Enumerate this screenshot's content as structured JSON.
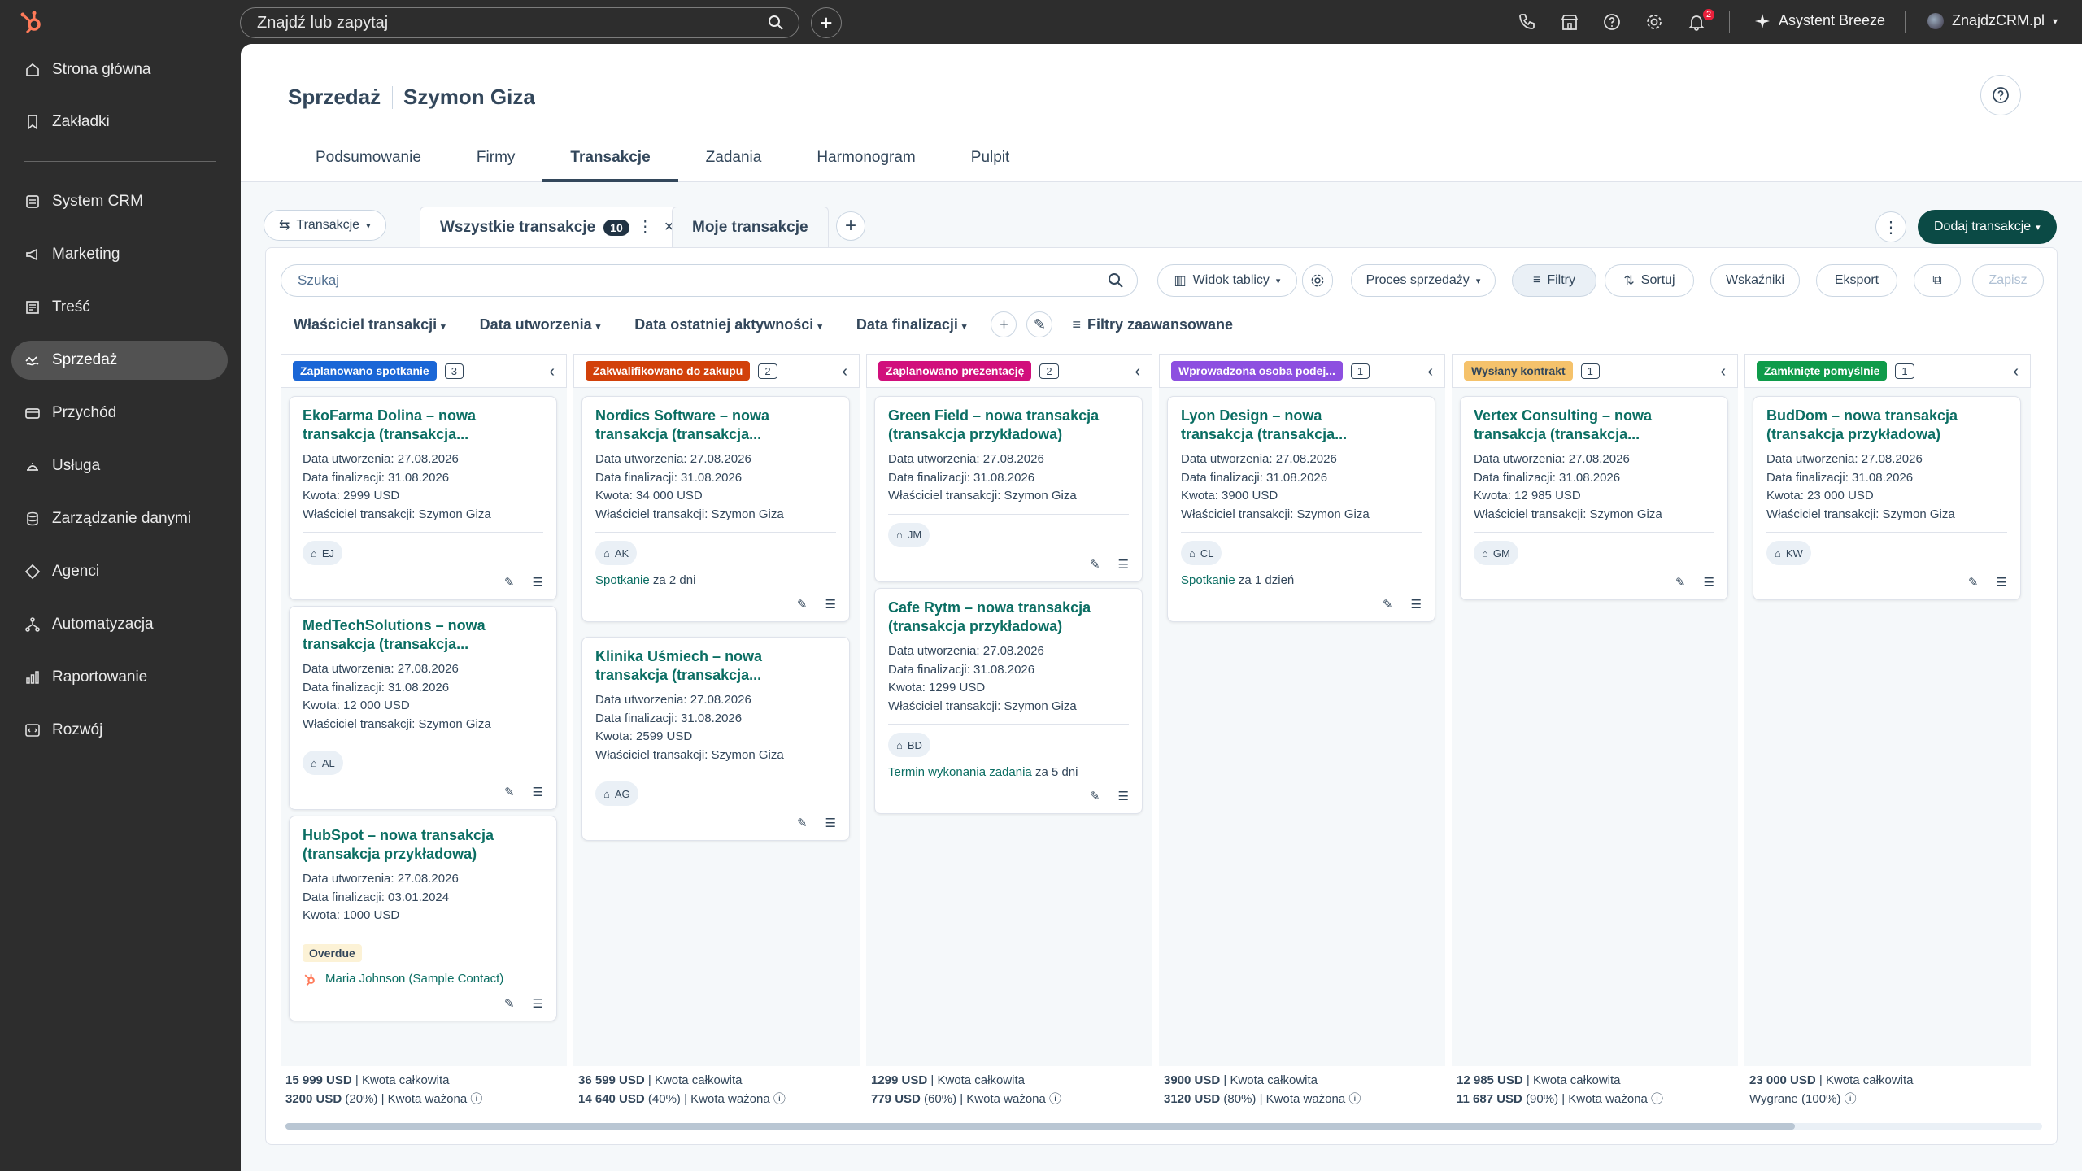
{
  "topbar": {
    "search_placeholder": "Znajdź lub zapytaj",
    "assistant_label": "Asystent Breeze",
    "notification_count": "2",
    "account_label": "ZnajdzCRM.pl"
  },
  "sidebar": {
    "items": [
      {
        "label": "Strona główna",
        "icon": "home-icon"
      },
      {
        "label": "Zakładki",
        "icon": "bookmark-icon"
      },
      {
        "label": "System CRM",
        "icon": "crm-icon"
      },
      {
        "label": "Marketing",
        "icon": "megaphone-icon"
      },
      {
        "label": "Treść",
        "icon": "content-icon"
      },
      {
        "label": "Sprzedaż",
        "icon": "sales-icon"
      },
      {
        "label": "Przychód",
        "icon": "revenue-icon"
      },
      {
        "label": "Usługa",
        "icon": "service-icon"
      },
      {
        "label": "Zarządzanie danymi",
        "icon": "database-icon"
      },
      {
        "label": "Agenci",
        "icon": "agents-icon"
      },
      {
        "label": "Automatyzacja",
        "icon": "automation-icon"
      },
      {
        "label": "Raportowanie",
        "icon": "reporting-icon"
      },
      {
        "label": "Rozwój",
        "icon": "development-icon"
      }
    ],
    "active": "Sprzedaż"
  },
  "header": {
    "title": "Sprzedaż",
    "subtitle": "Szymon Giza",
    "tabs": [
      "Podsumowanie",
      "Firmy",
      "Transakcje",
      "Zadania",
      "Harmonogram",
      "Pulpit"
    ],
    "active_tab": "Transakcje"
  },
  "views": {
    "object_label": "Transakcje",
    "tab_all": "Wszystkie transakcje",
    "tab_all_count": "10",
    "tab_mine": "Moje transakcje",
    "add_deal_label": "Dodaj transakcje"
  },
  "toolbar": {
    "search_placeholder": "Szukaj",
    "board_view": "Widok tablicy",
    "pipeline": "Proces sprzedaży",
    "filters": "Filtry",
    "sort": "Sortuj",
    "metrics": "Wskaźniki",
    "export": "Eksport",
    "save": "Zapisz"
  },
  "filters": {
    "owner": "Właściciel transakcji",
    "created": "Data utworzenia",
    "last_activity": "Data ostatniej aktywności",
    "close_date": "Data finalizacji",
    "advanced": "Filtry zaawansowane"
  },
  "columns": [
    {
      "stage": "Zaplanowano spotkanie",
      "count": "3",
      "color": "#1a66d6",
      "text_color": "#ffffff",
      "cards": [
        {
          "title1": "EkoFarma Dolina – nowa",
          "title2": "transakcja (transakcja...",
          "lines": [
            "Data utworzenia: 27.08.2026",
            "Data finalizacji: 31.08.2026",
            "Kwota: 2999 USD",
            "Właściciel transakcji: Szymon Giza"
          ],
          "initials": "EJ"
        },
        {
          "title1": "MedTechSolutions – nowa",
          "title2": "transakcja (transakcja...",
          "lines": [
            "Data utworzenia: 27.08.2026",
            "Data finalizacji: 31.08.2026",
            "Kwota: 12 000 USD",
            "Właściciel transakcji: Szymon Giza"
          ],
          "initials": "AL"
        },
        {
          "title1": "HubSpot – nowa transakcja",
          "title2": "(transakcja przykładowa)",
          "lines": [
            "Data utworzenia: 27.08.2026",
            "Data finalizacji: 03.01.2024",
            "Kwota: 1000 USD"
          ],
          "overdue": "Overdue",
          "contact": "Maria Johnson (Sample Contact)"
        }
      ],
      "total": "15 999 USD",
      "total_label": "| Kwota całkowita",
      "weighted": "3200 USD",
      "weighted_label": "(20%) | Kwota ważona"
    },
    {
      "stage": "Zakwalifikowano do zakupu",
      "count": "2",
      "color": "#d2410a",
      "text_color": "#ffffff",
      "cards": [
        {
          "title1": "Nordics Software – nowa",
          "title2": "transakcja (transakcja...",
          "lines": [
            "Data utworzenia: 27.08.2026",
            "Data finalizacji: 31.08.2026",
            "Kwota: 34 000 USD",
            "Właściciel transakcji: Szymon Giza"
          ],
          "initials": "AK",
          "task_link": "Spotkanie",
          "task_due": "za 2 dni"
        },
        {
          "title1": "Klinika Uśmiech – nowa",
          "title2": "transakcja (transakcja...",
          "lines": [
            "Data utworzenia: 27.08.2026",
            "Data finalizacji: 31.08.2026",
            "Kwota: 2599 USD",
            "Właściciel transakcji: Szymon Giza"
          ],
          "initials": "AG"
        }
      ],
      "total": "36 599 USD",
      "total_label": "| Kwota całkowita",
      "weighted": "14 640 USD",
      "weighted_label": "(40%) | Kwota ważona"
    },
    {
      "stage": "Zaplanowano prezentację",
      "count": "2",
      "color": "#d10f7c",
      "text_color": "#ffffff",
      "cards": [
        {
          "title1": "Green Field – nowa transakcja",
          "title2": "(transakcja przykładowa)",
          "lines": [
            "Data utworzenia: 27.08.2026",
            "Data finalizacji: 31.08.2026",
            "Właściciel transakcji: Szymon Giza"
          ],
          "initials": "JM"
        },
        {
          "title1": "Cafe Rytm – nowa transakcja",
          "title2": "(transakcja przykładowa)",
          "lines": [
            "Data utworzenia: 27.08.2026",
            "Data finalizacji: 31.08.2026",
            "Kwota: 1299 USD",
            "Właściciel transakcji: Szymon Giza"
          ],
          "initials": "BD",
          "task_link": "Termin wykonania zadania",
          "task_due": "za 5 dni"
        }
      ],
      "total": "1299 USD",
      "total_label": "| Kwota całkowita",
      "weighted": "779 USD",
      "weighted_label": "(60%) | Kwota ważona"
    },
    {
      "stage": "Wprowadzona osoba podej...",
      "count": "1",
      "color": "#8d4fe0",
      "text_color": "#ffffff",
      "cards": [
        {
          "title1": "Lyon Design – nowa",
          "title2": "transakcja (transakcja...",
          "lines": [
            "Data utworzenia: 27.08.2026",
            "Data finalizacji: 31.08.2026",
            "Kwota: 3900 USD",
            "Właściciel transakcji: Szymon Giza"
          ],
          "initials": "CL",
          "task_link": "Spotkanie",
          "task_due": "za 1 dzień"
        }
      ],
      "total": "3900 USD",
      "total_label": "| Kwota całkowita",
      "weighted": "3120 USD",
      "weighted_label": "(80%) | Kwota ważona"
    },
    {
      "stage": "Wysłany kontrakt",
      "count": "1",
      "color": "#f5c26b",
      "text_color": "#33475b",
      "cards": [
        {
          "title1": "Vertex Consulting – nowa",
          "title2": "transakcja (transakcja...",
          "lines": [
            "Data utworzenia: 27.08.2026",
            "Data finalizacji: 31.08.2026",
            "Kwota: 12 985 USD",
            "Właściciel transakcji: Szymon Giza"
          ],
          "initials": "GM"
        }
      ],
      "total": "12 985 USD",
      "total_label": "| Kwota całkowita",
      "weighted": "11 687 USD",
      "weighted_label": "(90%) | Kwota ważona"
    },
    {
      "stage": "Zamknięte pomyślnie",
      "count": "1",
      "color": "#0f9b4a",
      "text_color": "#ffffff",
      "cards": [
        {
          "title1": "BudDom – nowa transakcja",
          "title2": "(transakcja przykładowa)",
          "lines": [
            "Data utworzenia: 27.08.2026",
            "Data finalizacji: 31.08.2026",
            "Kwota: 23 000 USD",
            "Właściciel transakcji: Szymon Giza"
          ],
          "initials": "KW"
        }
      ],
      "total": "23 000 USD",
      "total_label": "| Kwota całkowita",
      "weighted": "",
      "weighted_label": "Wygrane (100%)"
    }
  ]
}
